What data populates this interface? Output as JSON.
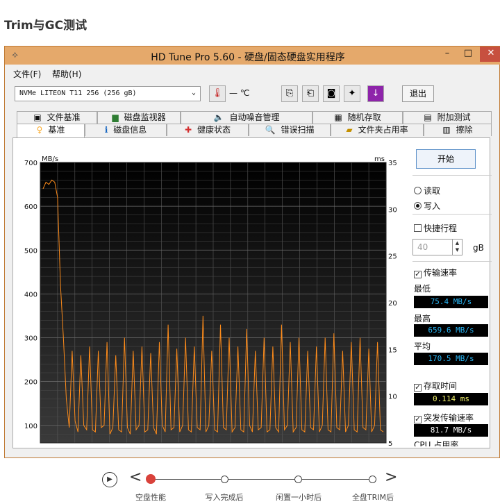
{
  "page_heading": "Trim与GC测试",
  "window": {
    "title": "HD Tune Pro 5.60 - 硬盘/固态硬盘实用程序",
    "controls": {
      "minimize": "–",
      "maximize": "□",
      "close": "✕"
    }
  },
  "menu": {
    "file": "文件(F)",
    "help": "帮助(H)"
  },
  "toolbar": {
    "drive": "NVMe    LITEON T11 256 (256 gB)",
    "temperature": "— ℃",
    "exit": "退出"
  },
  "tabs_top": [
    "文件基准",
    "磁盘监视器",
    "自动噪音管理",
    "随机存取",
    "附加测试"
  ],
  "tabs_bottom": [
    "基准",
    "磁盘信息",
    "健康状态",
    "错误扫描",
    "文件夹占用率",
    "擦除"
  ],
  "active_tab": "基准",
  "controls": {
    "start": "开始",
    "read": "读取",
    "write": "写入",
    "write_selected": true,
    "short_stroke": "快捷行程",
    "short_stroke_value": "40",
    "short_stroke_unit": "gB",
    "transfer_rate": "传输速率",
    "access_time": "存取时间",
    "burst_rate": "突发传输速率",
    "cpu_usage": "CPU 占用率"
  },
  "stats": {
    "min_label": "最低",
    "min_value": "75.4 MB/s",
    "max_label": "最高",
    "max_value": "659.6 MB/s",
    "avg_label": "平均",
    "avg_value": "170.5 MB/s",
    "access_value": "0.114 ms",
    "burst_value": "81.7 MB/s"
  },
  "chart_data": {
    "type": "line",
    "left_unit": "MB/s",
    "right_unit": "ms",
    "y_left_ticks": [
      100,
      200,
      300,
      400,
      500,
      600,
      700
    ],
    "y_right_ticks": [
      5,
      10,
      15,
      20,
      25,
      30,
      35
    ],
    "ylim_left": [
      60,
      700
    ],
    "ylim_right": [
      5,
      35
    ],
    "grid": true,
    "background": "#000000",
    "series": [
      {
        "color": "#ff8c1a",
        "note": "write transfer rate",
        "values": [
          640,
          655,
          650,
          660,
          655,
          620,
          420,
          300,
          160,
          95,
          270,
          110,
          85,
          260,
          100,
          90,
          280,
          90,
          85,
          270,
          95,
          100,
          290,
          80,
          95,
          260,
          90,
          85,
          300,
          95,
          80,
          270,
          90,
          100,
          280,
          85,
          90,
          265,
          95,
          80,
          290,
          100,
          85,
          330,
          90,
          95,
          275,
          85,
          100,
          300,
          90,
          85,
          280,
          95,
          90,
          350,
          85,
          100,
          270,
          90,
          85,
          330,
          95,
          90,
          300,
          85,
          95,
          280,
          90,
          85,
          320,
          100,
          85,
          270,
          90,
          95,
          300,
          85,
          90,
          280,
          95,
          85,
          330,
          90,
          100,
          290,
          85,
          95,
          300,
          90,
          85,
          270,
          95,
          90,
          280,
          85,
          100,
          300,
          90,
          85,
          310,
          95,
          90,
          270,
          85,
          100,
          290,
          90,
          85,
          300,
          95,
          90,
          275,
          85,
          100,
          290,
          90,
          85
        ]
      }
    ]
  },
  "timeline": {
    "steps": [
      "空盘性能",
      "写入完成后",
      "闲置一小时后",
      "全盘TRIM后"
    ],
    "active_index": 0
  }
}
